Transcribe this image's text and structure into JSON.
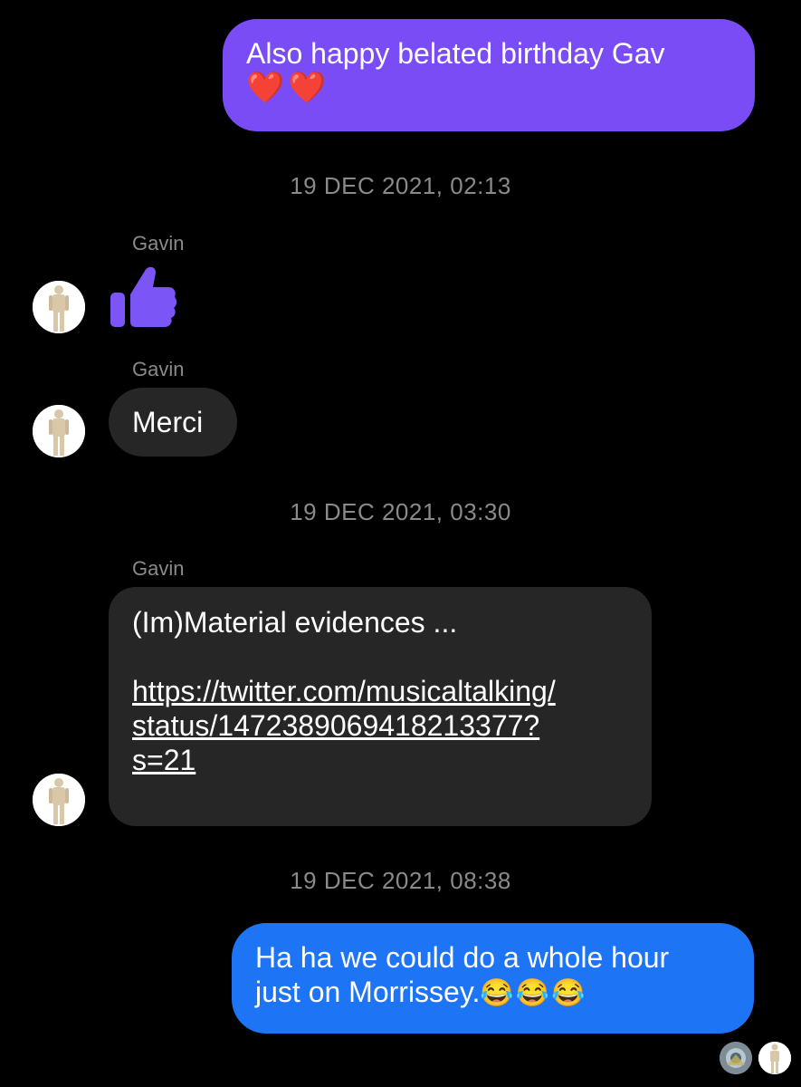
{
  "conversation": {
    "messages": [
      {
        "kind": "sent",
        "text": "Also happy belated birthday Gav",
        "emoji": "❤️❤️"
      },
      {
        "kind": "timestamp",
        "text": "19 DEC 2021, 02:13"
      },
      {
        "kind": "received",
        "sender": "Gavin",
        "content": "thumbs-up-icon"
      },
      {
        "kind": "received",
        "sender": "Gavin",
        "text": "Merci"
      },
      {
        "kind": "timestamp",
        "text": "19 DEC 2021, 03:30"
      },
      {
        "kind": "received",
        "sender": "Gavin",
        "text": "(Im)Material evidences ...",
        "link_lines": [
          "https://twitter.com/musicaltalking/",
          "status/1472389069418213377?",
          "s=21"
        ]
      },
      {
        "kind": "timestamp",
        "text": "19 DEC 2021, 08:38"
      },
      {
        "kind": "sent",
        "text_line1": "Ha ha we could do a whole hour",
        "text_line2": "just on Morrissey.",
        "emoji": "😂😂😂"
      }
    ]
  },
  "colors": {
    "sent_purple": "#7a4cf5",
    "sent_blue": "#1d74f5",
    "received_bubble": "#262626",
    "background": "#000000",
    "meta_text": "#8a8a8a"
  },
  "icons": [
    "avatar-gavin",
    "thumbs-up-icon",
    "read-receipt-avatar"
  ]
}
